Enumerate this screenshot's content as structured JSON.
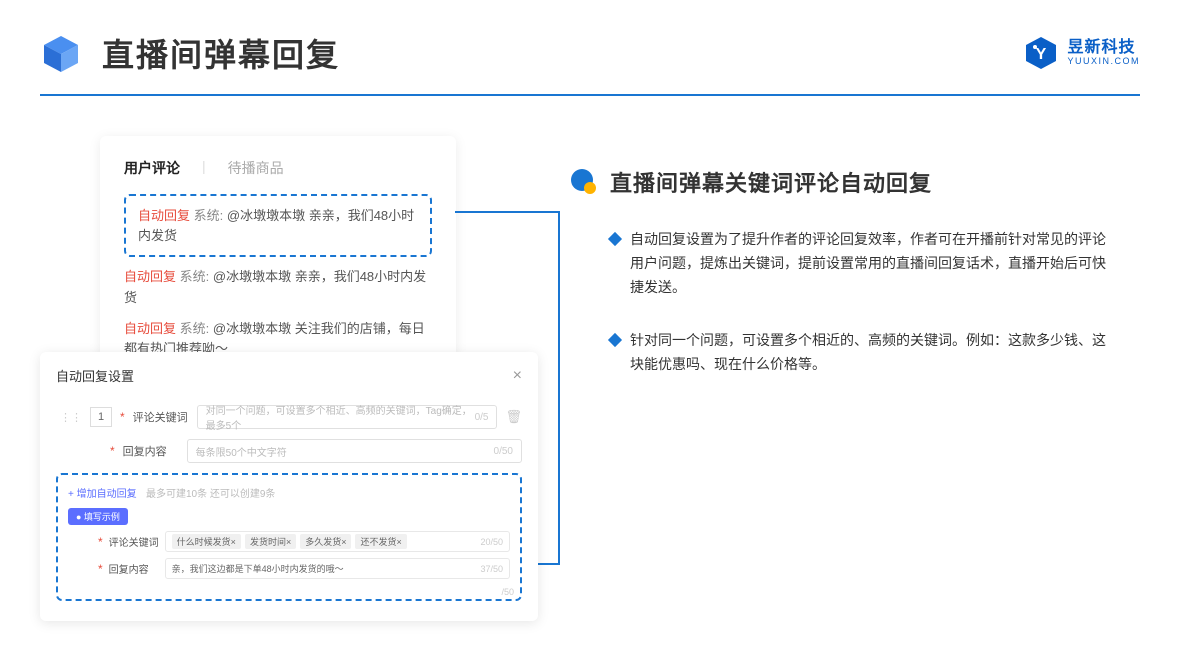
{
  "header": {
    "title": "直播间弹幕回复",
    "brand_cn": "昱新科技",
    "brand_en": "YUUXIN.COM"
  },
  "comments_card": {
    "tab_active": "用户评论",
    "tab_inactive": "待播商品",
    "highlight": {
      "tag": "自动回复",
      "sys": "系统:",
      "text": "@冰墩墩本墩 亲亲，我们48小时内发货"
    },
    "rows": [
      {
        "tag": "自动回复",
        "sys": "系统:",
        "text": "@冰墩墩本墩 亲亲，我们48小时内发货"
      },
      {
        "tag": "自动回复",
        "sys": "系统:",
        "text": "@冰墩墩本墩 关注我们的店铺，每日都有热门推荐呦～"
      }
    ]
  },
  "settings": {
    "title": "自动回复设置",
    "num": "1",
    "keyword_label": "评论关键词",
    "keyword_placeholder": "对同一个问题，可设置多个相近、高频的关键词，Tag确定，最多5个",
    "keyword_count": "0/5",
    "content_label": "回复内容",
    "content_placeholder": "每条限50个中文字符",
    "content_count": "0/50",
    "add_link": "+ 增加自动回复",
    "add_hint": "最多可建10条 还可以创建9条",
    "example_badge": "● 填写示例",
    "ex_keyword_label": "评论关键词",
    "ex_tags": [
      "什么时候发货×",
      "发货时间×",
      "多久发货×",
      "还不发货×"
    ],
    "ex_tag_count": "20/50",
    "ex_content_label": "回复内容",
    "ex_content_text": "亲，我们这边都是下单48小时内发货的哦～",
    "ex_content_count": "37/50",
    "outer_count": "/50"
  },
  "right": {
    "section_title": "直播间弹幕关键词评论自动回复",
    "bullets": [
      "自动回复设置为了提升作者的评论回复效率，作者可在开播前针对常见的评论用户问题，提炼出关键词，提前设置常用的直播间回复话术，直播开始后可快捷发送。",
      "针对同一个问题，可设置多个相近的、高频的关键词。例如：这款多少钱、这块能优惠吗、现在什么价格等。"
    ]
  }
}
